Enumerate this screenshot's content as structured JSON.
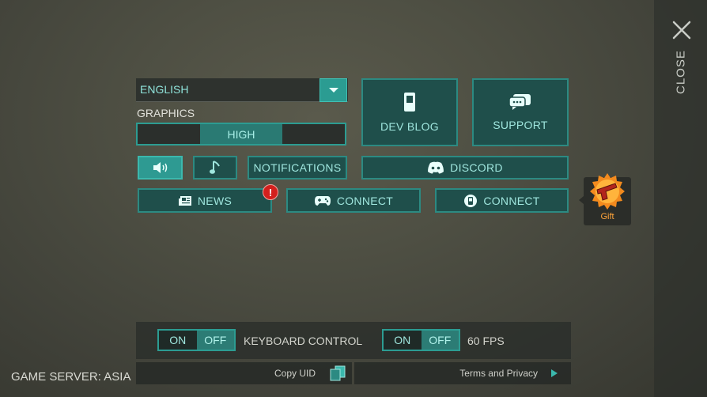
{
  "close": {
    "label": "CLOSE",
    "icon": "close-icon"
  },
  "language": {
    "selected": "ENGLISH",
    "icon": "chevron-down-icon"
  },
  "graphics": {
    "label": "GRAPHICS",
    "selected": "HIGH"
  },
  "buttons": {
    "dev_blog": "DEV BLOG",
    "support": "SUPPORT",
    "notifications": "NOTIFICATIONS",
    "discord": "DISCORD",
    "news": "NEWS",
    "connect_gamepad": "CONNECT",
    "connect_phone": "CONNECT"
  },
  "news_alert": "!",
  "gift": {
    "label": "Gift"
  },
  "settings": {
    "keyboard": {
      "on": "ON",
      "off": "OFF",
      "label": "KEYBOARD CONTROL",
      "state": "OFF"
    },
    "fps": {
      "on": "ON",
      "off": "OFF",
      "label": "60 FPS",
      "state": "OFF"
    }
  },
  "footer": {
    "copy_uid": "Copy UID",
    "terms": "Terms and Privacy",
    "server": "GAME SERVER: ASIA"
  },
  "colors": {
    "accent": "#2c9c92",
    "button_bg": "#1f4f4b",
    "alert": "#d3201d",
    "gift": "#ffa43a"
  }
}
